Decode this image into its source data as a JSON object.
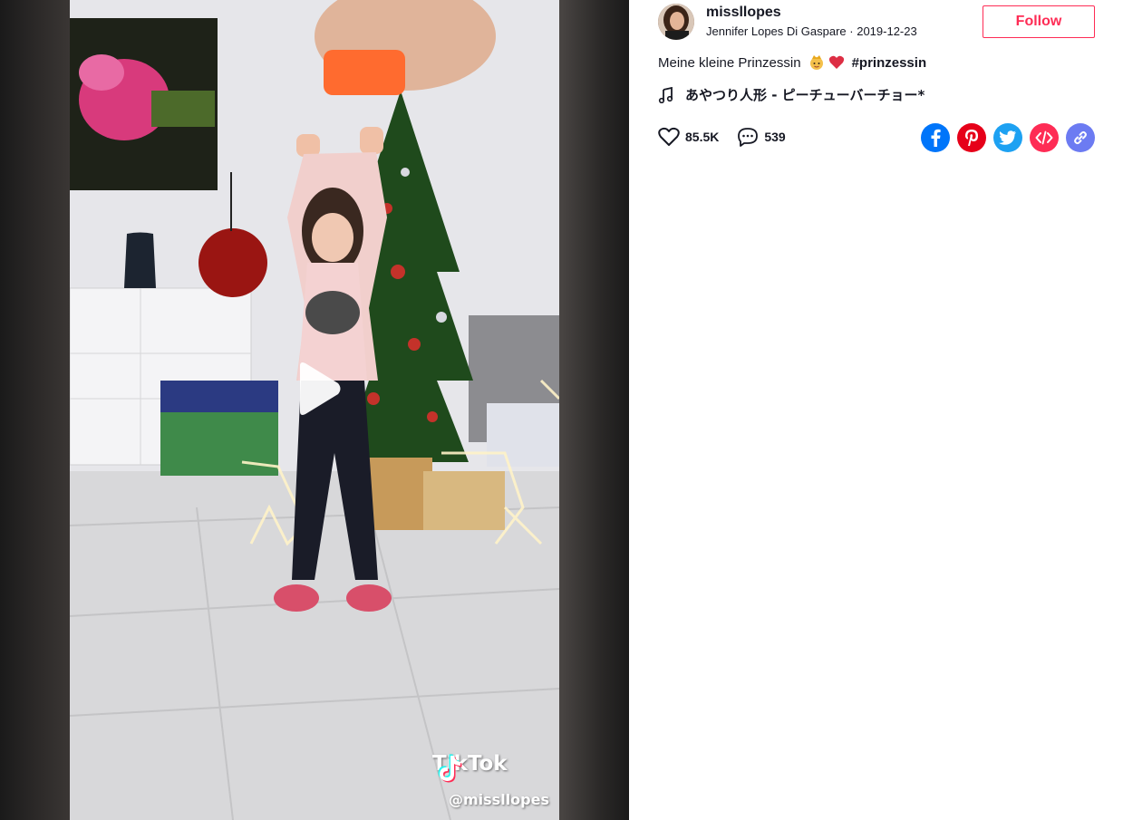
{
  "video": {
    "watermark_brand": "TikTok",
    "watermark_handle": "@missllopes",
    "play_icon": "play-icon"
  },
  "author": {
    "username": "missllopes",
    "display_name": "Jennifer Lopes Di Gaspare",
    "separator": " · ",
    "date": "2019-12-23",
    "follow_label": "Follow"
  },
  "caption": {
    "text": "Meine kleine Prinzessin",
    "emojis": [
      "princess-emoji",
      "red-heart-emoji"
    ],
    "hashtag": "#prinzessin"
  },
  "music": {
    "icon": "music-note-icon",
    "title": "あやつり人形 - ピーチューバーチョー*"
  },
  "stats": {
    "likes": "85.5K",
    "comments": "539"
  },
  "share": {
    "items": [
      "facebook-icon",
      "pinterest-icon",
      "twitter-icon",
      "embed-icon",
      "link-icon"
    ]
  },
  "colors": {
    "accent": "#fe2c55",
    "facebook": "#0075fa",
    "pinterest": "#e60019",
    "twitter": "#1da1f2",
    "embed": "#fe2c55",
    "link": "#6c7bf2"
  }
}
